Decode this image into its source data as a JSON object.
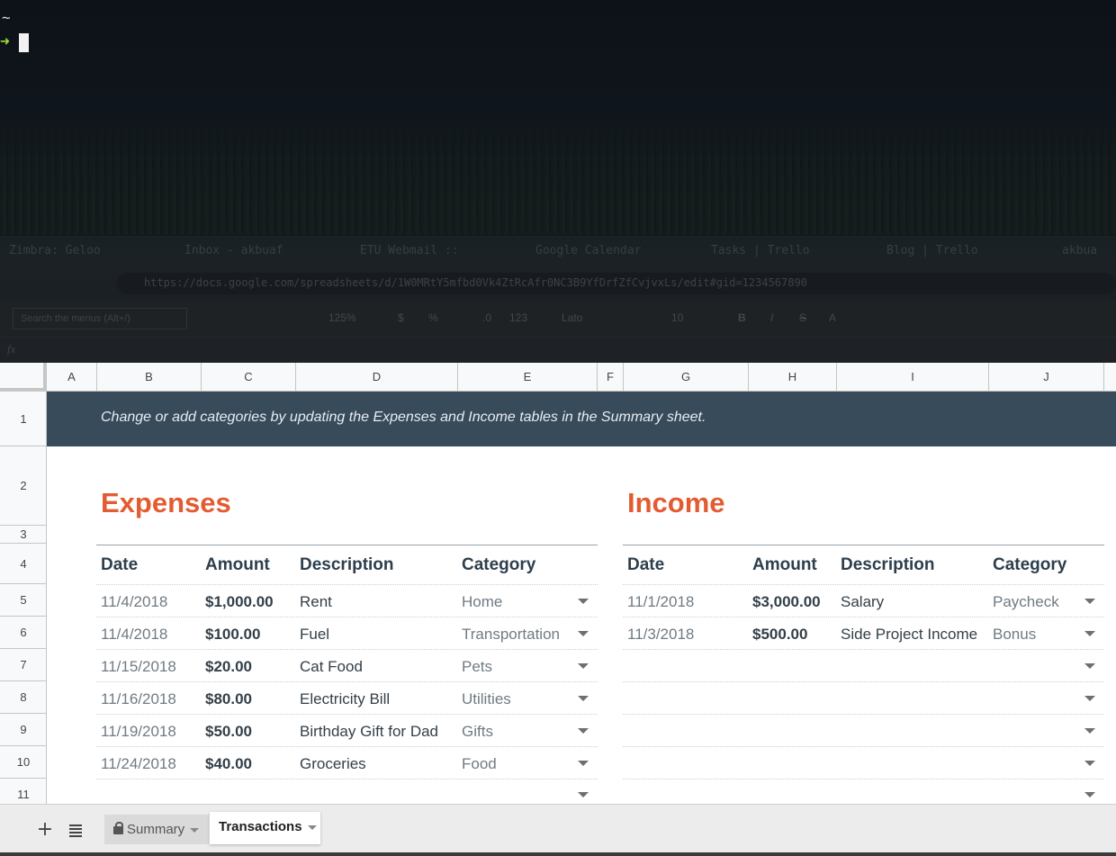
{
  "terminal": {
    "home": "~",
    "prompt_symbol": "➜"
  },
  "browser": {
    "tabs": [
      "Zimbra: Geloo",
      "Inbox - akbuaf",
      "ETU Webmail ::",
      "Google Calendar",
      "Tasks | Trello",
      "Blog | Trello",
      "akbua"
    ],
    "url": "https://docs.google.com/spreadsheets/d/1W0MRtY5mfbd0Vk4ZtRcAfr0NC3B9YfDrfZfCvjvxLs/edit#gid=1234567890"
  },
  "sheets_toolbar": {
    "menu_search": "Search the menus (Alt+/)",
    "zoom": "125%",
    "currency": "$",
    "percent": "%",
    "decimal": ".0",
    "more_formats": "123",
    "font": "Lato",
    "font_size": "10",
    "bold": "B",
    "italic": "I",
    "strike": "S",
    "text_color": "A",
    "formula_icon": "fx"
  },
  "columns": [
    "A",
    "B",
    "C",
    "D",
    "E",
    "F",
    "G",
    "H",
    "I",
    "J"
  ],
  "rows": [
    "1",
    "2",
    "3",
    "4",
    "5",
    "6",
    "7",
    "8",
    "9",
    "10",
    "11"
  ],
  "banner": "Change or add categories by updating the Expenses and Income tables in the Summary sheet.",
  "expenses": {
    "title": "Expenses",
    "headers": {
      "date": "Date",
      "amount": "Amount",
      "description": "Description",
      "category": "Category"
    },
    "rows": [
      {
        "date": "11/4/2018",
        "amount": "$1,000.00",
        "description": "Rent",
        "category": "Home"
      },
      {
        "date": "11/4/2018",
        "amount": "$100.00",
        "description": "Fuel",
        "category": "Transportation"
      },
      {
        "date": "11/15/2018",
        "amount": "$20.00",
        "description": "Cat Food",
        "category": "Pets"
      },
      {
        "date": "11/16/2018",
        "amount": "$80.00",
        "description": "Electricity Bill",
        "category": "Utilities"
      },
      {
        "date": "11/19/2018",
        "amount": "$50.00",
        "description": "Birthday Gift for Dad",
        "category": "Gifts"
      },
      {
        "date": "11/24/2018",
        "amount": "$40.00",
        "description": "Groceries",
        "category": "Food"
      }
    ]
  },
  "income": {
    "title": "Income",
    "headers": {
      "date": "Date",
      "amount": "Amount",
      "description": "Description",
      "category": "Category"
    },
    "rows": [
      {
        "date": "11/1/2018",
        "amount": "$3,000.00",
        "description": "Salary",
        "category": "Paycheck"
      },
      {
        "date": "11/3/2018",
        "amount": "$500.00",
        "description": "Side Project Income",
        "category": "Bonus"
      }
    ]
  },
  "sheet_tabs": {
    "add": "+",
    "summary": "Summary",
    "transactions": "Transactions"
  },
  "colors": {
    "accent": "#e35c31",
    "banner_bg": "#384b5b",
    "header_text": "#2d3e4c"
  }
}
